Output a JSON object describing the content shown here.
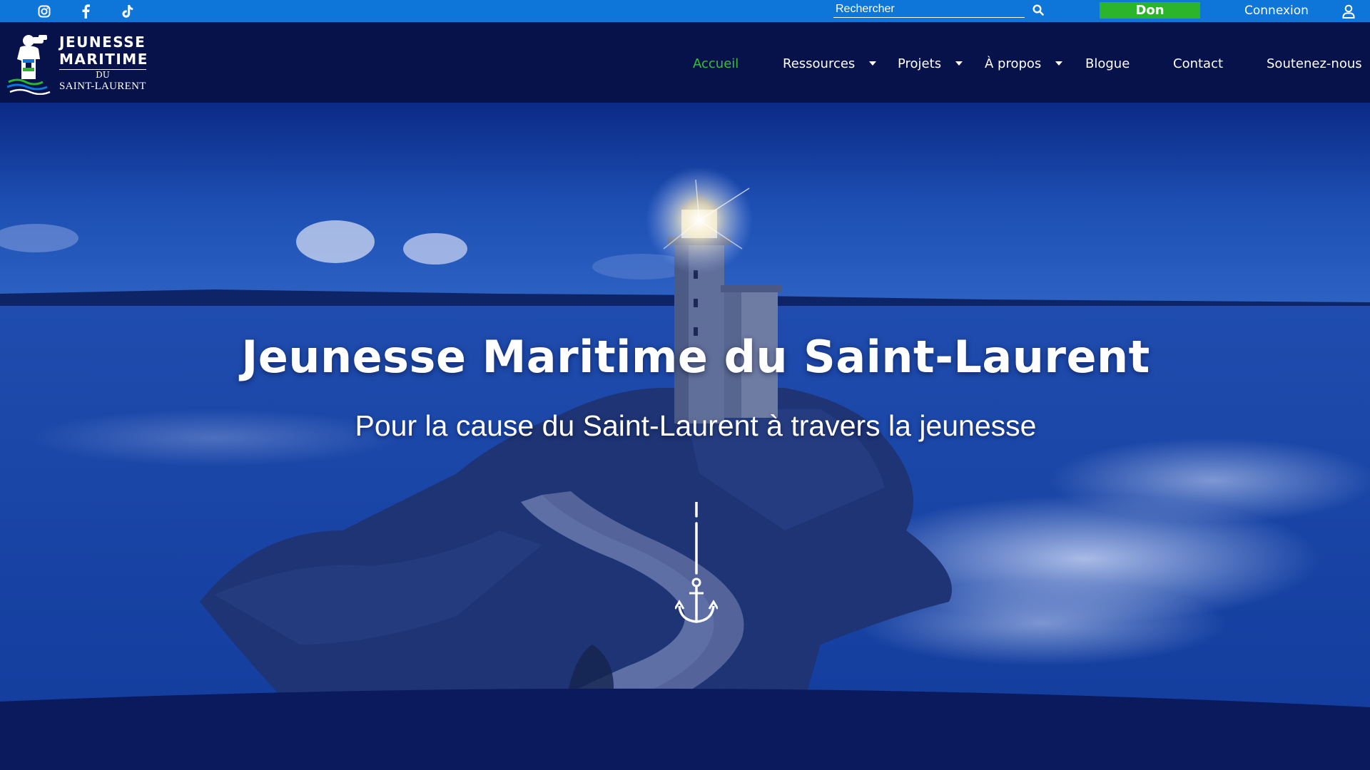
{
  "topbar": {
    "social": [
      {
        "name": "instagram-icon"
      },
      {
        "name": "facebook-icon"
      },
      {
        "name": "tiktok-icon"
      }
    ],
    "search_placeholder": "Rechercher",
    "donate_label": "Don",
    "login_label": "Connexion",
    "colors": {
      "bar": "#0f76d9",
      "donate": "#2bb52b"
    }
  },
  "header": {
    "logo": {
      "line1": "JEUNESSE",
      "line2": "MARITIME",
      "du": "DU",
      "line3": "SAINT-LAURENT"
    },
    "nav": [
      {
        "label": "Accueil",
        "active": true,
        "dropdown": false
      },
      {
        "label": "Ressources",
        "active": false,
        "dropdown": true
      },
      {
        "label": "Projets",
        "active": false,
        "dropdown": true
      },
      {
        "label": "À propos",
        "active": false,
        "dropdown": true
      },
      {
        "label": "Blogue",
        "active": false,
        "dropdown": false
      },
      {
        "label": "Contact",
        "active": false,
        "dropdown": false
      },
      {
        "label": "Soutenez-nous",
        "active": false,
        "dropdown": false
      }
    ],
    "colors": {
      "background": "#08124a",
      "active": "#35c03a"
    }
  },
  "hero": {
    "title": "Jeunesse Maritime du Saint-Laurent",
    "subtitle": "Pour la cause du Saint-Laurent à travers la jeunesse",
    "scroll_icon": "anchor-icon"
  }
}
